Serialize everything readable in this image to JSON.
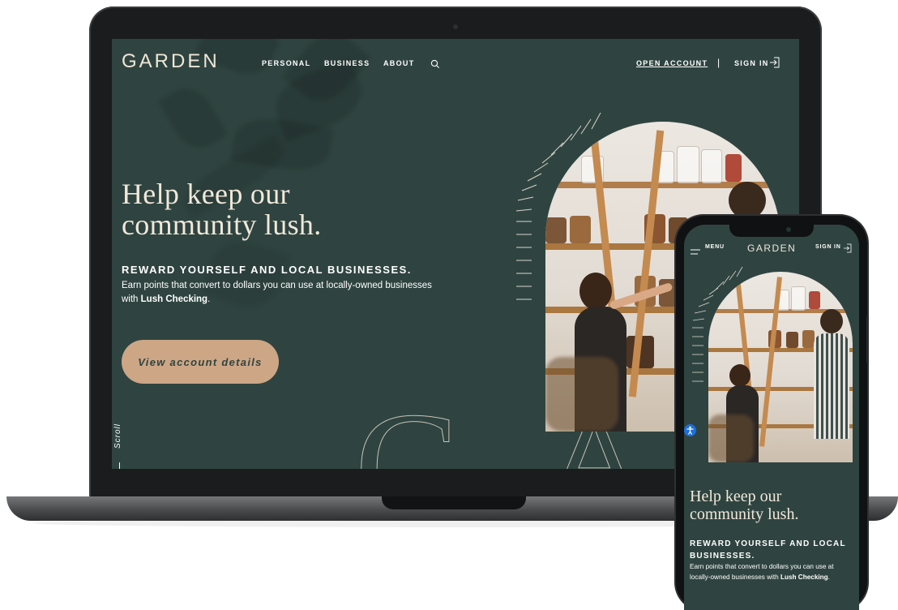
{
  "laptop": {
    "brand": "GARDEN",
    "nav": [
      "PERSONAL",
      "BUSINESS",
      "ABOUT"
    ],
    "open_account": "OPEN ACCOUNT",
    "divider": "|",
    "sign_in": "SIGN IN",
    "hero": {
      "title": "Help keep our community lush.",
      "subtitle": "REWARD YOURSELF AND LOCAL BUSINESSES.",
      "body_text": "Earn points that convert to dollars you can use at locally-owned businesses with",
      "body_link": "Lush Checking",
      "body_end": ".",
      "cta": "View account details"
    },
    "scroll": "Scroll",
    "watermark_letters": [
      "G",
      "A"
    ]
  },
  "phone": {
    "menu": "MENU",
    "brand": "GARDEN",
    "sign_in": "SIGN IN",
    "hero": {
      "title": "Help keep our community lush.",
      "subtitle": "REWARD YOURSELF AND LOCAL BUSINESSES.",
      "body_text": "Earn points that convert to dollars you can use at locally-owned businesses with",
      "body_link": "Lush Checking",
      "body_end": "."
    }
  },
  "colors": {
    "background": "#2f4440",
    "accent": "#cda686",
    "heading": "#f1e8da",
    "accessibility": "#1d6fe0"
  },
  "icons": [
    "search-icon",
    "sign-in-icon",
    "menu-icon",
    "accessibility-icon"
  ]
}
